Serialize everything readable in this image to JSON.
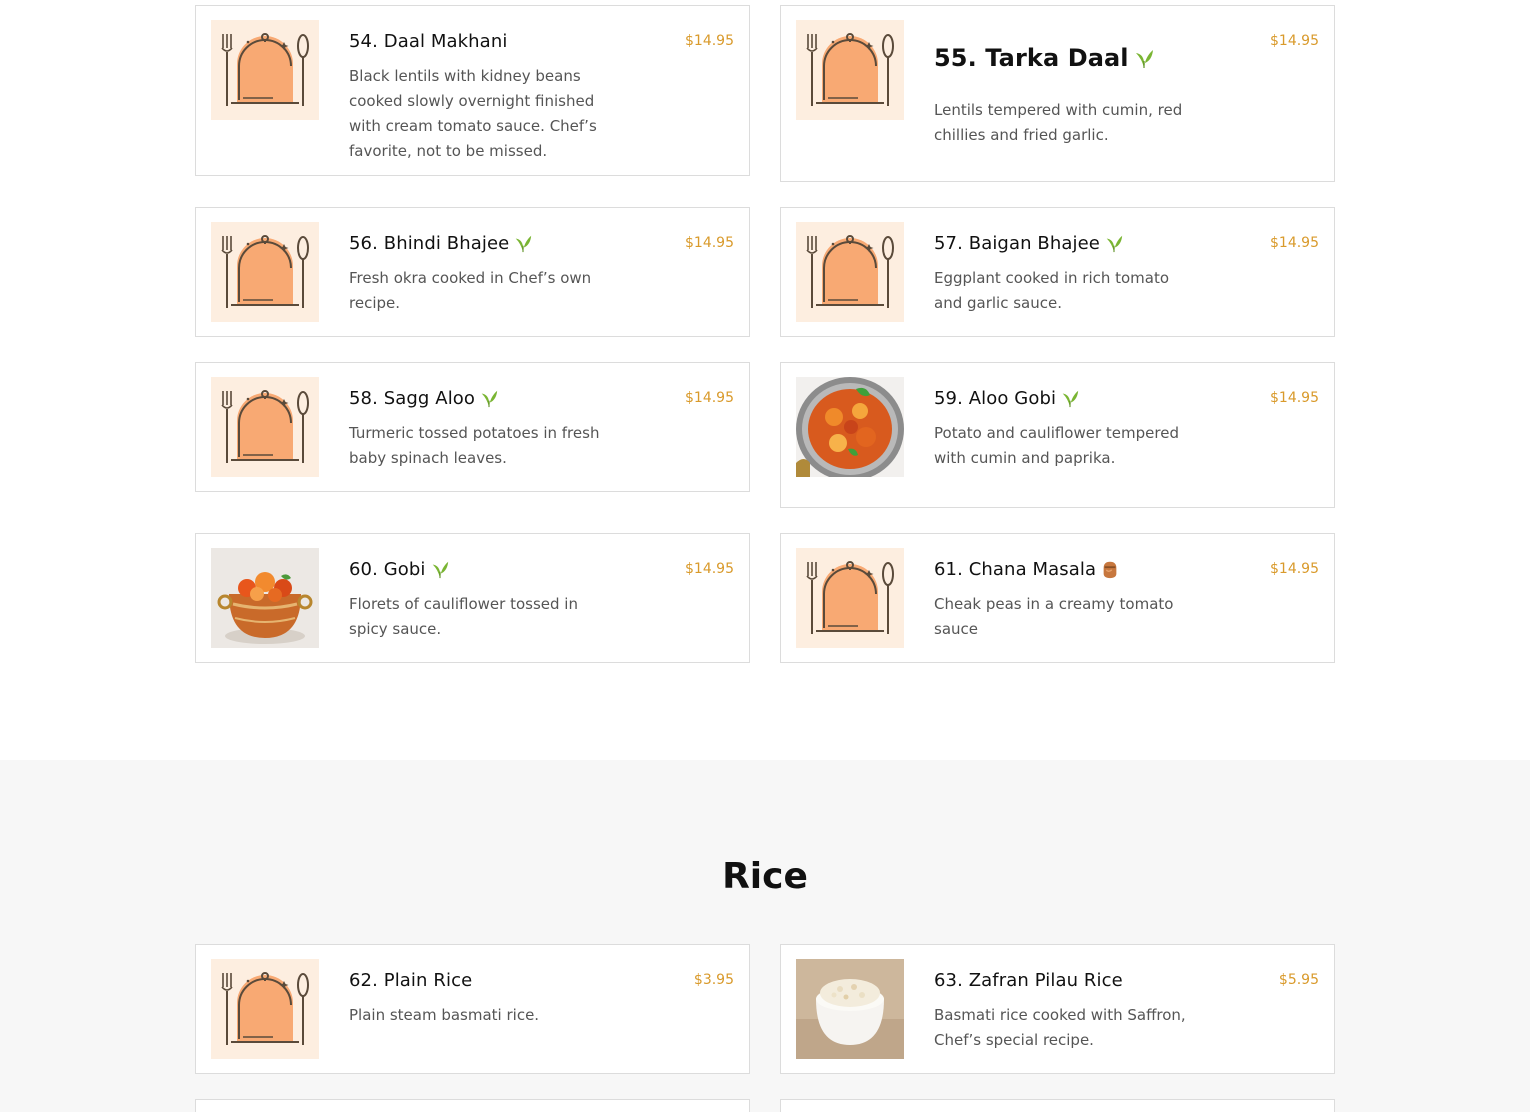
{
  "colors": {
    "price": "#d99a2b",
    "veg_leaf": "#7ab533",
    "nut_tag": "#c7773e",
    "placeholder_bg": "#fdeee0",
    "placeholder_dome": "#f8a973"
  },
  "dishes": [
    {
      "title": "54. Daal Makhani",
      "price": "$14.95",
      "desc": "Black lentils with kidney beans cooked slowly overnight finished with cream tomato sauce. Chef’s favorite, not to be missed.",
      "tag": "",
      "image": "placeholder-cloche"
    },
    {
      "title": "55. Tarka Daal",
      "price": "$14.95",
      "desc": "Lentils tempered with cumin, red chillies and fried garlic.",
      "tag": "vegetarian-leaf",
      "image": "placeholder-cloche"
    },
    {
      "title": "56. Bhindi Bhajee",
      "price": "$14.95",
      "desc": "Fresh okra cooked in Chef’s own recipe.",
      "tag": "vegetarian-leaf",
      "image": "placeholder-cloche"
    },
    {
      "title": "57. Baigan Bhajee",
      "price": "$14.95",
      "desc": "Eggplant cooked in rich tomato and garlic sauce.",
      "tag": "vegetarian-leaf",
      "image": "placeholder-cloche"
    },
    {
      "title": "58. Sagg Aloo",
      "price": "$14.95",
      "desc": "Turmeric tossed potatoes in fresh baby spinach leaves.",
      "tag": "vegetarian-leaf",
      "image": "placeholder-cloche"
    },
    {
      "title": "59. Aloo Gobi",
      "price": "$14.95",
      "desc": "Potato and cauliflower tempered with cumin and paprika.",
      "tag": "vegetarian-leaf",
      "image": "curry-pot-photo"
    },
    {
      "title": "60. Gobi",
      "price": "$14.95",
      "desc": "Florets of cauliflower tossed in spicy sauce.",
      "tag": "vegetarian-leaf",
      "image": "copper-bowl-photo"
    },
    {
      "title": "61. Chana Masala",
      "price": "$14.95",
      "desc": "Cheak peas in a creamy tomato sauce",
      "tag": "nut-icon",
      "image": "placeholder-cloche"
    }
  ],
  "rice_section": {
    "title": "Rice",
    "dishes": [
      {
        "title": "62. Plain Rice",
        "price": "$3.95",
        "desc": "Plain steam basmati rice.",
        "tag": "",
        "image": "placeholder-cloche"
      },
      {
        "title": "63. Zafran Pilau Rice",
        "price": "$5.95",
        "desc": "Basmati rice cooked with Saffron, Chef’s special recipe.",
        "tag": "",
        "image": "rice-bowl-photo"
      }
    ]
  }
}
